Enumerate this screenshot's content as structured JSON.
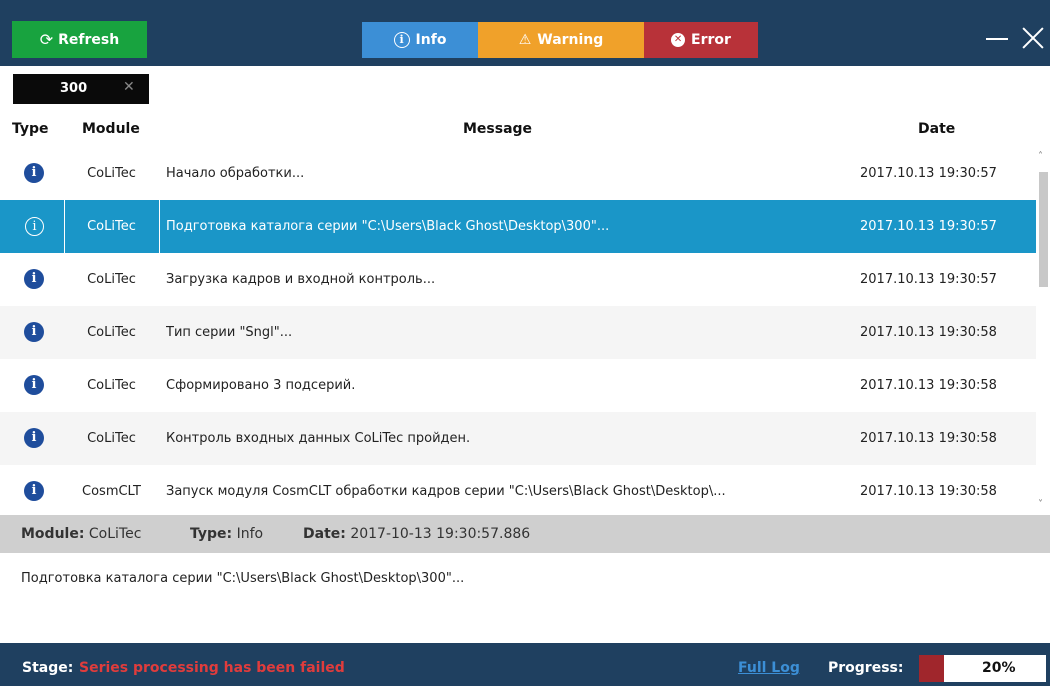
{
  "toolbar": {
    "refresh_label": "Refresh",
    "filters": [
      {
        "label": "Info"
      },
      {
        "label": "Warning"
      },
      {
        "label": "Error"
      }
    ]
  },
  "tab": {
    "label": "300"
  },
  "table": {
    "headers": {
      "type": "Type",
      "module": "Module",
      "message": "Message",
      "date": "Date"
    },
    "rows": [
      {
        "module": "CoLiTec",
        "message": "Начало обработки...",
        "date": "2017.10.13 19:30:57"
      },
      {
        "module": "CoLiTec",
        "message": "Подготовка каталога серии \"C:\\Users\\Black Ghost\\Desktop\\300\"...",
        "date": "2017.10.13 19:30:57"
      },
      {
        "module": "CoLiTec",
        "message": "Загрузка кадров и входной контроль...",
        "date": "2017.10.13 19:30:57"
      },
      {
        "module": "CoLiTec",
        "message": "Тип серии \"Sngl\"...",
        "date": "2017.10.13 19:30:58"
      },
      {
        "module": "CoLiTec",
        "message": "Сформировано 3 подсерий.",
        "date": "2017.10.13 19:30:58"
      },
      {
        "module": "CoLiTec",
        "message": "Контроль входных данных CoLiTec пройден.",
        "date": "2017.10.13 19:30:58"
      },
      {
        "module": "CosmCLT",
        "message": "Запуск модуля CosmCLT обработки кадров серии \"C:\\Users\\Black Ghost\\Desktop\\...",
        "date": "2017.10.13 19:30:58"
      }
    ],
    "selected_index": 1
  },
  "details": {
    "module_label": "Module:",
    "module_value": "CoLiTec",
    "type_label": "Type:",
    "type_value": "Info",
    "date_label": "Date:",
    "date_value": "2017-10-13 19:30:57.886",
    "message": "Подготовка каталога серии \"C:\\Users\\Black Ghost\\Desktop\\300\"..."
  },
  "status": {
    "stage_label": "Stage:",
    "stage_value": "Series processing has been failed",
    "full_log": "Full Log",
    "progress_label": "Progress:",
    "progress_text": "20%",
    "progress_fraction": 0.2
  },
  "colors": {
    "header_bg": "#1f4060",
    "refresh": "#18a33f",
    "info": "#3c8fd6",
    "warning": "#f0a12a",
    "error": "#b83239",
    "selected_row": "#1a96c8",
    "stage_error_text": "#e03c3c",
    "progress_fill": "#a0262c"
  },
  "icons": {
    "row_type": "info-icon",
    "refresh": "refresh-icon"
  }
}
